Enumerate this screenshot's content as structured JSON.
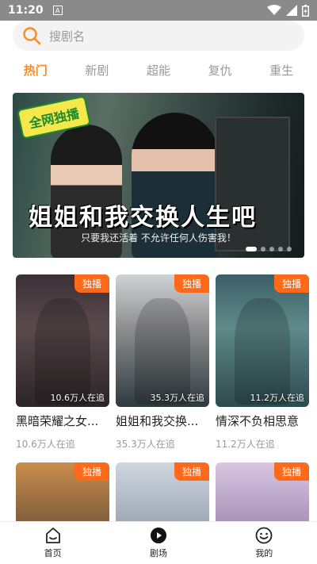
{
  "status_bar": {
    "time": "11:20",
    "sim_icon": "A"
  },
  "search": {
    "placeholder": "搜剧名"
  },
  "tabs": [
    {
      "label": "热门",
      "active": true
    },
    {
      "label": "新剧",
      "active": false
    },
    {
      "label": "超能",
      "active": false
    },
    {
      "label": "复仇",
      "active": false
    },
    {
      "label": "重生",
      "active": false
    }
  ],
  "banner": {
    "badge": "全网独播",
    "title": "姐姐和我交换人生吧",
    "subtitle": "只要我还活着 不允许任何人伤害我！",
    "pages": 5,
    "current_page": 1
  },
  "dramas_row1": [
    {
      "tag": "独播",
      "viewers": "10.6万人在追",
      "title": "黑暗荣耀之女...",
      "followers": "10.6万人在追"
    },
    {
      "tag": "独播",
      "viewers": "35.3万人在追",
      "title": "姐姐和我交换...",
      "followers": "35.3万人在追"
    },
    {
      "tag": "独播",
      "viewers": "11.2万人在追",
      "title": "情深不负相思意",
      "followers": "11.2万人在追"
    }
  ],
  "dramas_row2": [
    {
      "tag": "独播"
    },
    {
      "tag": "独播"
    },
    {
      "tag": "独播"
    }
  ],
  "tabbar": {
    "home": "首页",
    "theater": "剧场",
    "mine": "我的"
  },
  "colors": {
    "accent": "#ff8a1f",
    "tag": "#ff6a1a"
  }
}
